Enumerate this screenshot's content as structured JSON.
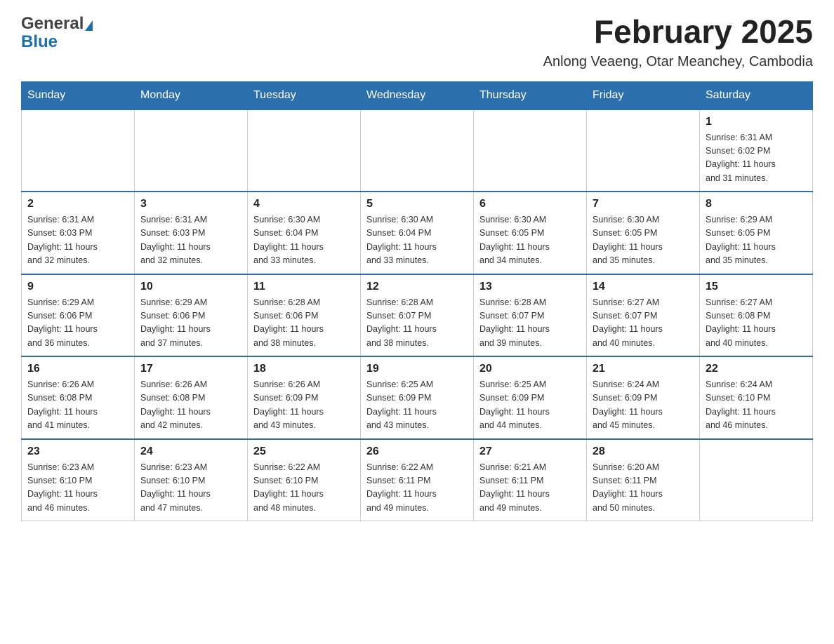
{
  "header": {
    "logo_general": "General",
    "logo_blue": "Blue",
    "month_title": "February 2025",
    "location": "Anlong Veaeng, Otar Meanchey, Cambodia"
  },
  "weekdays": [
    "Sunday",
    "Monday",
    "Tuesday",
    "Wednesday",
    "Thursday",
    "Friday",
    "Saturday"
  ],
  "weeks": [
    [
      {
        "day": "",
        "info": ""
      },
      {
        "day": "",
        "info": ""
      },
      {
        "day": "",
        "info": ""
      },
      {
        "day": "",
        "info": ""
      },
      {
        "day": "",
        "info": ""
      },
      {
        "day": "",
        "info": ""
      },
      {
        "day": "1",
        "info": "Sunrise: 6:31 AM\nSunset: 6:02 PM\nDaylight: 11 hours\nand 31 minutes."
      }
    ],
    [
      {
        "day": "2",
        "info": "Sunrise: 6:31 AM\nSunset: 6:03 PM\nDaylight: 11 hours\nand 32 minutes."
      },
      {
        "day": "3",
        "info": "Sunrise: 6:31 AM\nSunset: 6:03 PM\nDaylight: 11 hours\nand 32 minutes."
      },
      {
        "day": "4",
        "info": "Sunrise: 6:30 AM\nSunset: 6:04 PM\nDaylight: 11 hours\nand 33 minutes."
      },
      {
        "day": "5",
        "info": "Sunrise: 6:30 AM\nSunset: 6:04 PM\nDaylight: 11 hours\nand 33 minutes."
      },
      {
        "day": "6",
        "info": "Sunrise: 6:30 AM\nSunset: 6:05 PM\nDaylight: 11 hours\nand 34 minutes."
      },
      {
        "day": "7",
        "info": "Sunrise: 6:30 AM\nSunset: 6:05 PM\nDaylight: 11 hours\nand 35 minutes."
      },
      {
        "day": "8",
        "info": "Sunrise: 6:29 AM\nSunset: 6:05 PM\nDaylight: 11 hours\nand 35 minutes."
      }
    ],
    [
      {
        "day": "9",
        "info": "Sunrise: 6:29 AM\nSunset: 6:06 PM\nDaylight: 11 hours\nand 36 minutes."
      },
      {
        "day": "10",
        "info": "Sunrise: 6:29 AM\nSunset: 6:06 PM\nDaylight: 11 hours\nand 37 minutes."
      },
      {
        "day": "11",
        "info": "Sunrise: 6:28 AM\nSunset: 6:06 PM\nDaylight: 11 hours\nand 38 minutes."
      },
      {
        "day": "12",
        "info": "Sunrise: 6:28 AM\nSunset: 6:07 PM\nDaylight: 11 hours\nand 38 minutes."
      },
      {
        "day": "13",
        "info": "Sunrise: 6:28 AM\nSunset: 6:07 PM\nDaylight: 11 hours\nand 39 minutes."
      },
      {
        "day": "14",
        "info": "Sunrise: 6:27 AM\nSunset: 6:07 PM\nDaylight: 11 hours\nand 40 minutes."
      },
      {
        "day": "15",
        "info": "Sunrise: 6:27 AM\nSunset: 6:08 PM\nDaylight: 11 hours\nand 40 minutes."
      }
    ],
    [
      {
        "day": "16",
        "info": "Sunrise: 6:26 AM\nSunset: 6:08 PM\nDaylight: 11 hours\nand 41 minutes."
      },
      {
        "day": "17",
        "info": "Sunrise: 6:26 AM\nSunset: 6:08 PM\nDaylight: 11 hours\nand 42 minutes."
      },
      {
        "day": "18",
        "info": "Sunrise: 6:26 AM\nSunset: 6:09 PM\nDaylight: 11 hours\nand 43 minutes."
      },
      {
        "day": "19",
        "info": "Sunrise: 6:25 AM\nSunset: 6:09 PM\nDaylight: 11 hours\nand 43 minutes."
      },
      {
        "day": "20",
        "info": "Sunrise: 6:25 AM\nSunset: 6:09 PM\nDaylight: 11 hours\nand 44 minutes."
      },
      {
        "day": "21",
        "info": "Sunrise: 6:24 AM\nSunset: 6:09 PM\nDaylight: 11 hours\nand 45 minutes."
      },
      {
        "day": "22",
        "info": "Sunrise: 6:24 AM\nSunset: 6:10 PM\nDaylight: 11 hours\nand 46 minutes."
      }
    ],
    [
      {
        "day": "23",
        "info": "Sunrise: 6:23 AM\nSunset: 6:10 PM\nDaylight: 11 hours\nand 46 minutes."
      },
      {
        "day": "24",
        "info": "Sunrise: 6:23 AM\nSunset: 6:10 PM\nDaylight: 11 hours\nand 47 minutes."
      },
      {
        "day": "25",
        "info": "Sunrise: 6:22 AM\nSunset: 6:10 PM\nDaylight: 11 hours\nand 48 minutes."
      },
      {
        "day": "26",
        "info": "Sunrise: 6:22 AM\nSunset: 6:11 PM\nDaylight: 11 hours\nand 49 minutes."
      },
      {
        "day": "27",
        "info": "Sunrise: 6:21 AM\nSunset: 6:11 PM\nDaylight: 11 hours\nand 49 minutes."
      },
      {
        "day": "28",
        "info": "Sunrise: 6:20 AM\nSunset: 6:11 PM\nDaylight: 11 hours\nand 50 minutes."
      },
      {
        "day": "",
        "info": ""
      }
    ]
  ]
}
